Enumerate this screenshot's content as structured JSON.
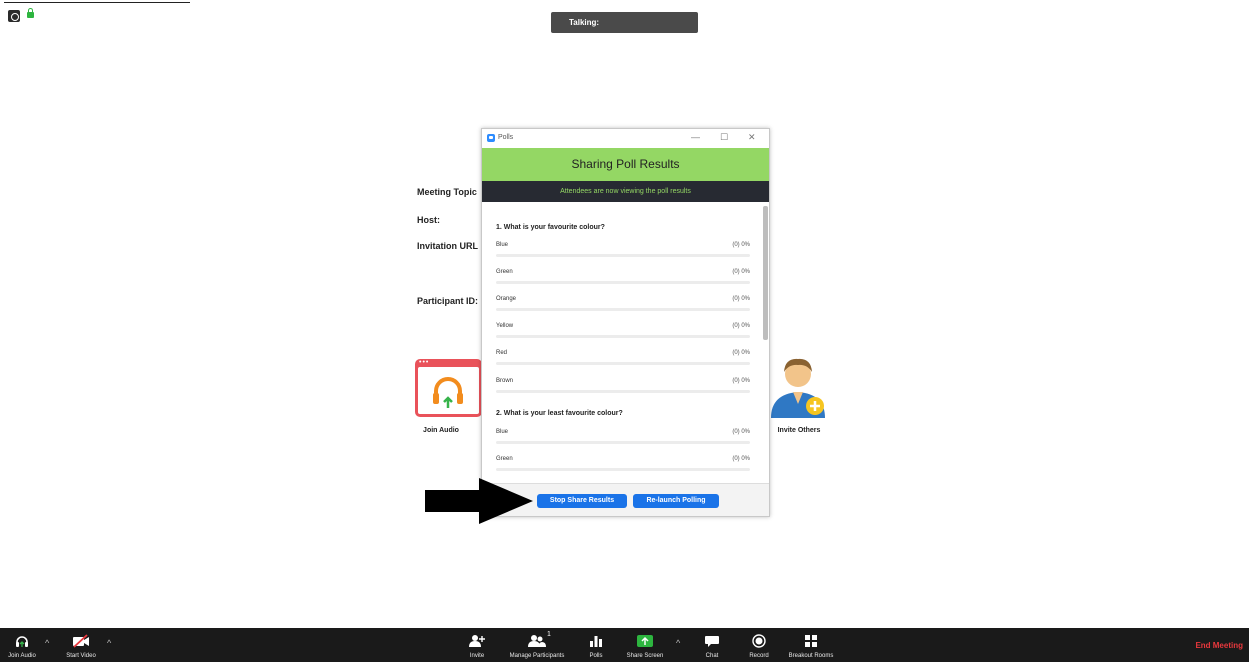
{
  "talking_label": "Talking:",
  "meeting_info": {
    "topic_label": "Meeting Topic",
    "host_label": "Host:",
    "invitation_label": "Invitation URL",
    "participant_label": "Participant ID:"
  },
  "tiles": {
    "join_audio": "Join Audio",
    "invite_others": "Invite Others"
  },
  "dialog": {
    "window_title": "Polls",
    "banner": "Sharing Poll Results",
    "sub_banner": "Attendees are now viewing the poll results",
    "questions": [
      {
        "title": "1. What is your favourite colour?",
        "options": [
          {
            "label": "Blue",
            "value": "(0) 0%"
          },
          {
            "label": "Green",
            "value": "(0) 0%"
          },
          {
            "label": "Orange",
            "value": "(0) 0%"
          },
          {
            "label": "Yellow",
            "value": "(0) 0%"
          },
          {
            "label": "Red",
            "value": "(0) 0%"
          },
          {
            "label": "Brown",
            "value": "(0) 0%"
          }
        ]
      },
      {
        "title": "2. What is your least favourite colour?",
        "options": [
          {
            "label": "Blue",
            "value": "(0) 0%"
          },
          {
            "label": "Green",
            "value": "(0) 0%"
          }
        ]
      }
    ],
    "stop_share_button": "Stop Share Results",
    "relaunch_button": "Re-launch Polling"
  },
  "toolbar": {
    "join_audio": "Join Audio",
    "start_video": "Start Video",
    "invite": "Invite",
    "manage_participants": "Manage Participants",
    "participant_count": "1",
    "polls": "Polls",
    "share_screen": "Share Screen",
    "chat": "Chat",
    "record": "Record",
    "breakout_rooms": "Breakout Rooms",
    "end_meeting": "End Meeting"
  },
  "colors": {
    "accent_blue": "#1a73e8",
    "banner_green": "#94d764",
    "end_red": "#e8383d",
    "toolbar_bg": "#1a1a1a"
  }
}
